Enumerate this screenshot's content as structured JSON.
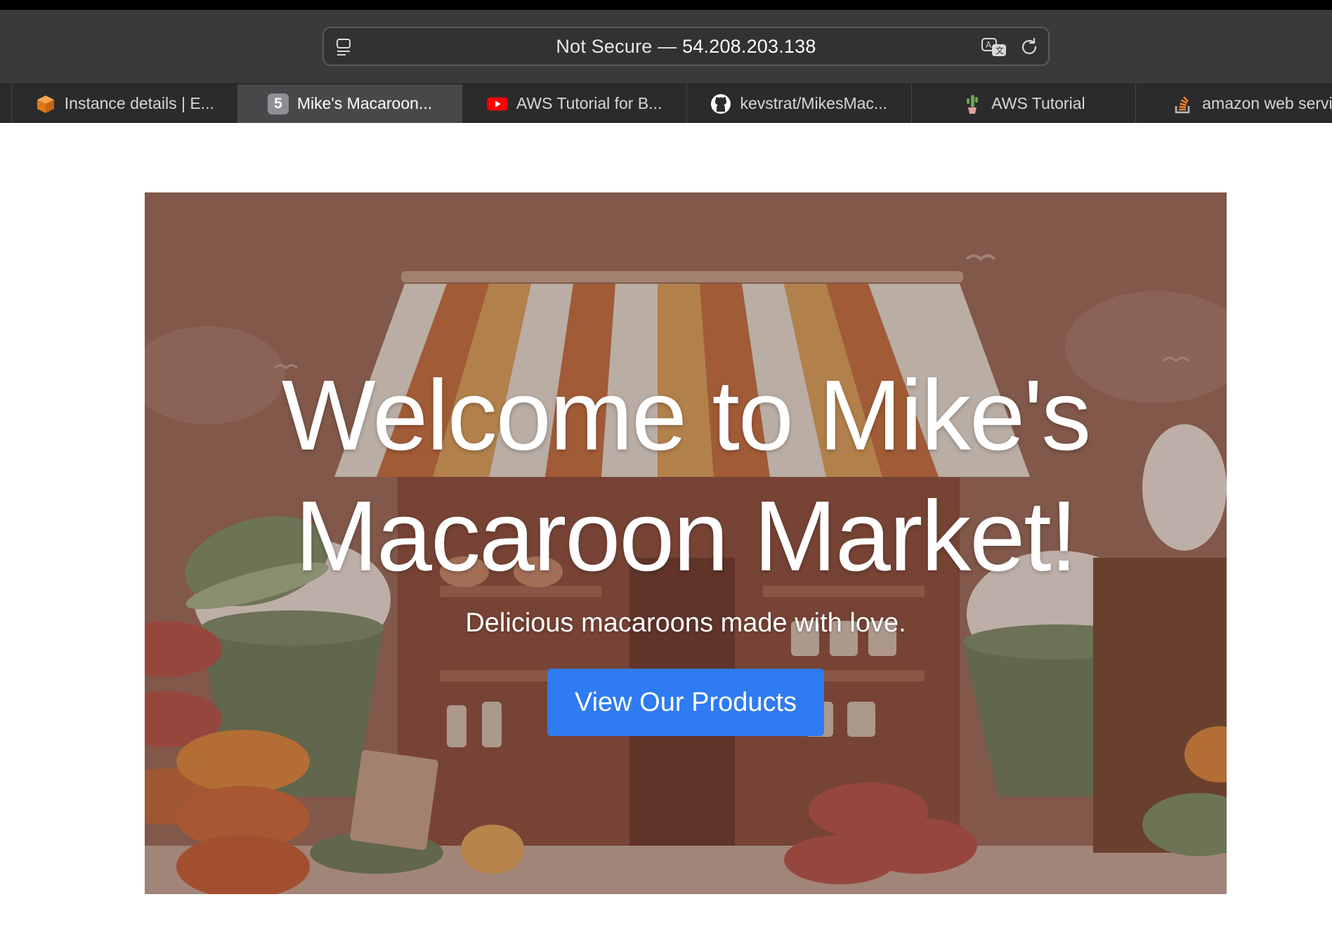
{
  "browser": {
    "address_bar": {
      "security": "Not Secure",
      "separator": " — ",
      "host": "54.208.203.138"
    },
    "tabs": [
      {
        "label": "Instance details | E...",
        "icon": "aws-cube-icon",
        "active": false
      },
      {
        "label": "Mike's Macaroon...",
        "icon": "number-badge-icon",
        "badge": "5",
        "active": true
      },
      {
        "label": "AWS Tutorial for B...",
        "icon": "youtube-icon",
        "active": false
      },
      {
        "label": "kevstrat/MikesMac...",
        "icon": "github-icon",
        "active": false
      },
      {
        "label": "AWS Tutorial",
        "icon": "cactus-icon",
        "active": false
      },
      {
        "label": "amazon web servic",
        "icon": "stackoverflow-icon",
        "active": false
      }
    ]
  },
  "hero": {
    "title_line1": "Welcome to Mike's",
    "title_line2": "Macaroon Market!",
    "subtitle": "Delicious macaroons made with love.",
    "cta_label": "View Our Products"
  },
  "colors": {
    "cta": "#2f7bf2",
    "chrome": "#3a3a3c",
    "active_tab": "#48484b"
  }
}
